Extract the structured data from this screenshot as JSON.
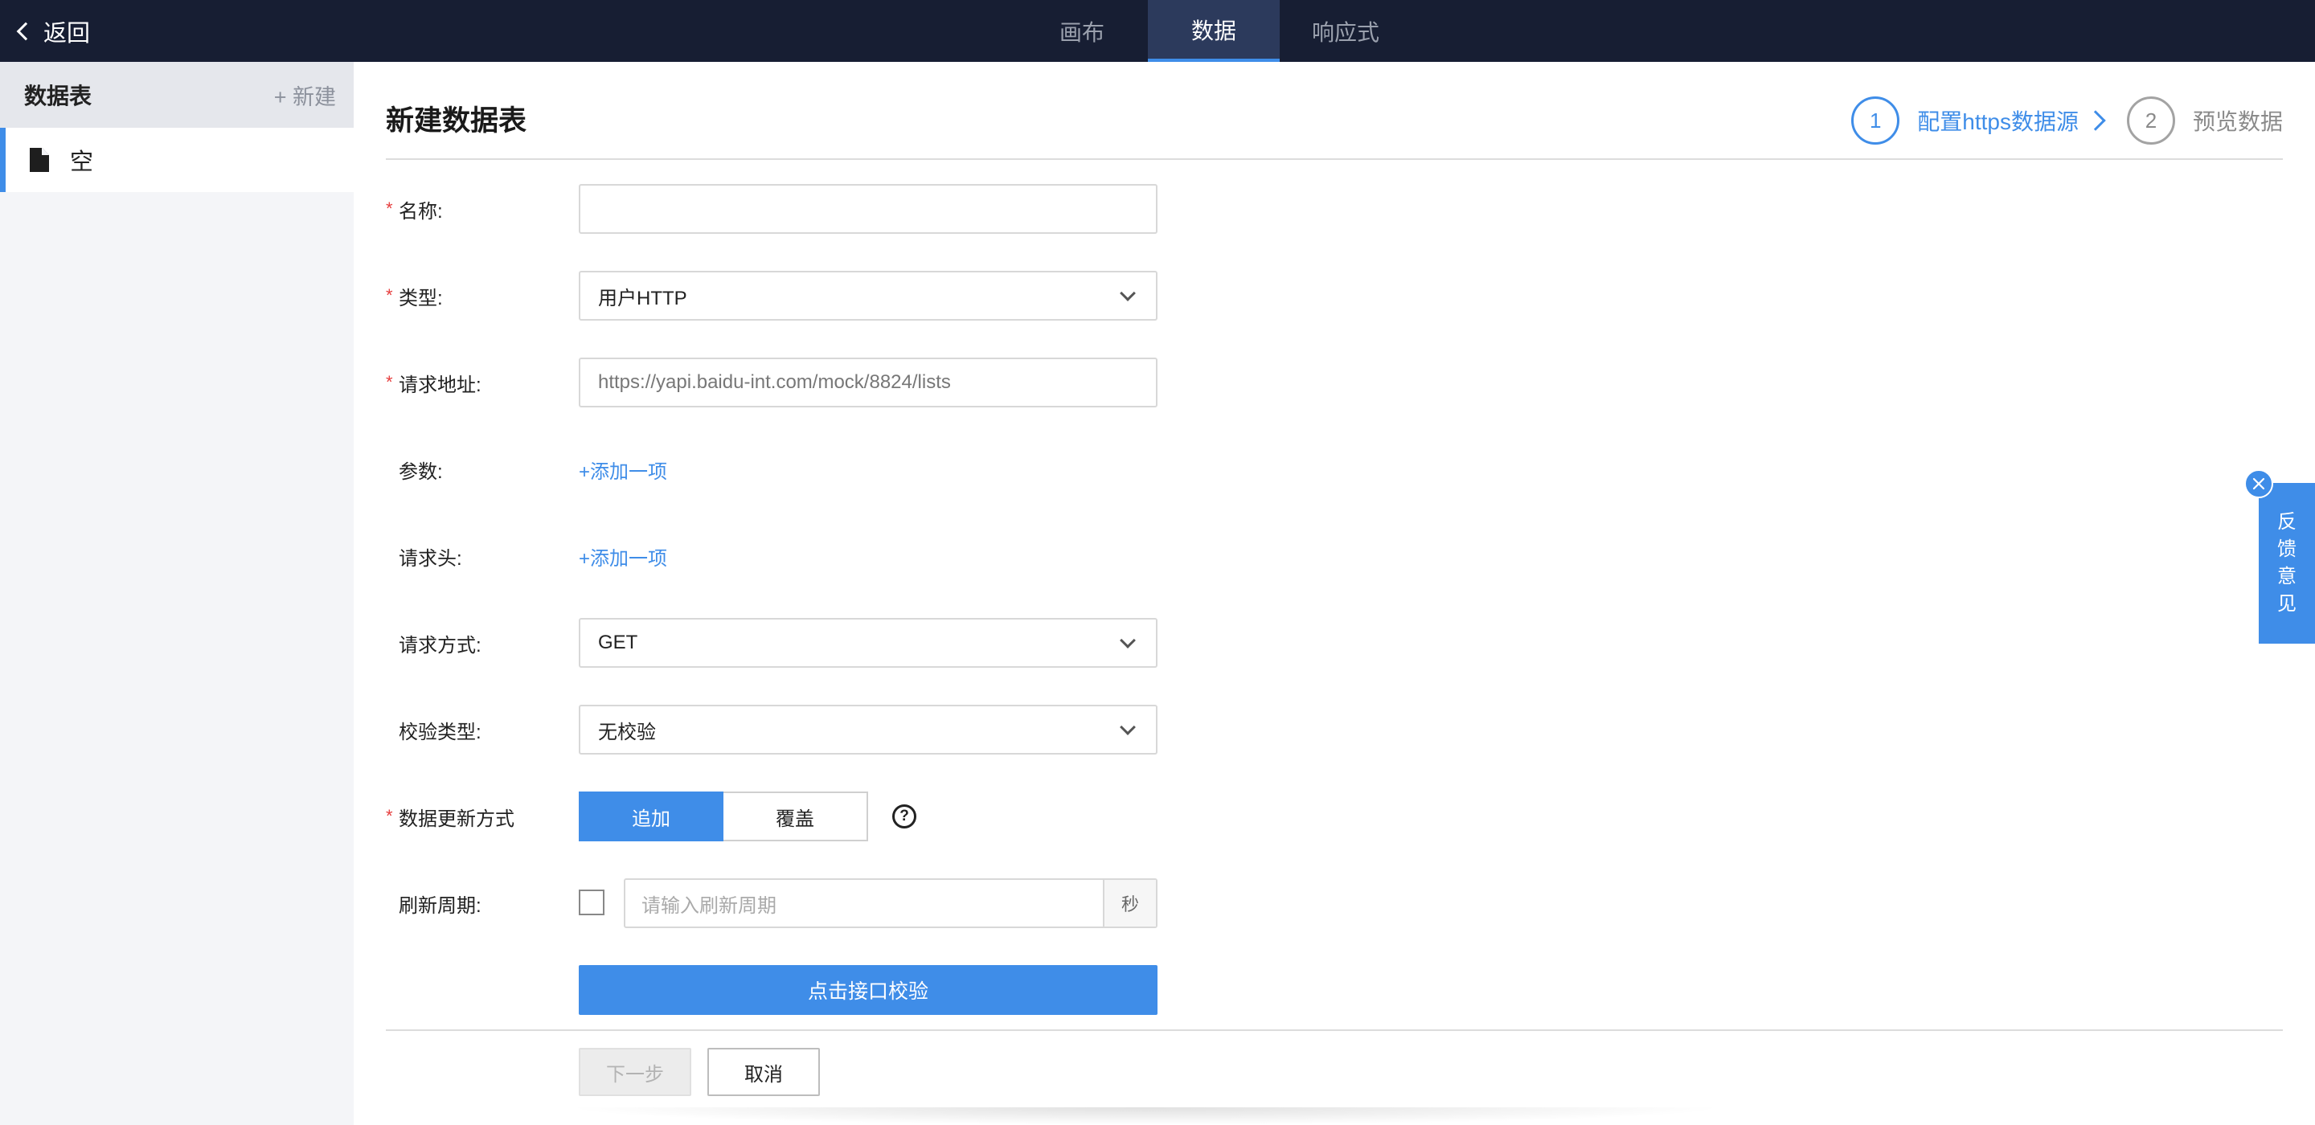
{
  "topbar": {
    "back_label": "返回",
    "tabs": [
      {
        "label": "画布"
      },
      {
        "label": "数据"
      },
      {
        "label": "响应式"
      }
    ]
  },
  "sidebar": {
    "title": "数据表",
    "new_label": "+ 新建",
    "items": [
      {
        "label": "空",
        "icon": "document-icon"
      }
    ]
  },
  "main": {
    "title": "新建数据表",
    "steps": [
      {
        "number": "1",
        "label": "配置https数据源"
      },
      {
        "number": "2",
        "label": "预览数据"
      }
    ],
    "form": {
      "name": {
        "label": "名称:",
        "value": ""
      },
      "type": {
        "label": "类型:",
        "value": "用户HTTP"
      },
      "url": {
        "label": "请求地址:",
        "value": "https://yapi.baidu-int.com/mock/8824/lists"
      },
      "params": {
        "label": "参数:",
        "add_label": "+添加一项"
      },
      "headers": {
        "label": "请求头:",
        "add_label": "+添加一项"
      },
      "method": {
        "label": "请求方式:",
        "value": "GET"
      },
      "validation": {
        "label": "校验类型:",
        "value": "无校验"
      },
      "update_mode": {
        "label": "数据更新方式",
        "options": [
          "追加",
          "覆盖"
        ],
        "selected": "追加",
        "help": "?"
      },
      "refresh": {
        "label": "刷新周期:",
        "placeholder": "请输入刷新周期",
        "unit": "秒"
      },
      "verify_label": "点击接口校验"
    },
    "footer": {
      "next_label": "下一步",
      "cancel_label": "取消"
    }
  },
  "feedback": {
    "chars": [
      "反",
      "馈",
      "意",
      "见"
    ]
  },
  "colors": {
    "topbar_bg": "#171e33",
    "accent": "#3f8de8",
    "required": "#e63e3e"
  }
}
